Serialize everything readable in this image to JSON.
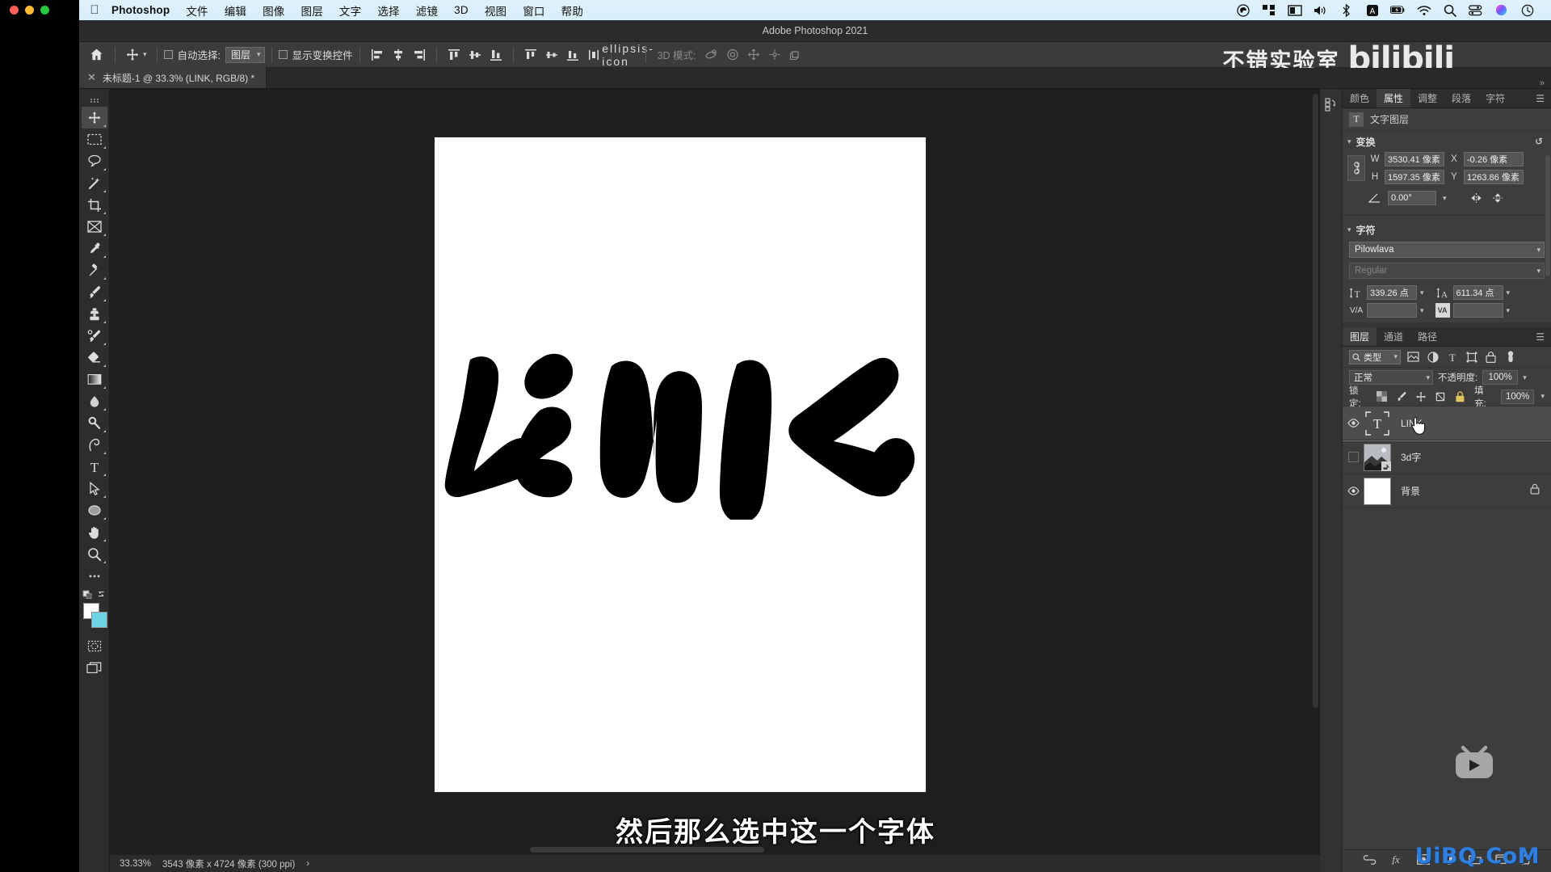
{
  "macbar": {
    "apple_icon": "apple-icon",
    "app_name": "Photoshop",
    "menus": [
      "文件",
      "编辑",
      "图像",
      "图层",
      "文字",
      "选择",
      "滤镜",
      "3D",
      "视图",
      "窗口",
      "帮助"
    ],
    "status_icons": [
      "dropbox-icon",
      "grid-icon",
      "display-icon",
      "volume-icon",
      "bluetooth-icon",
      "input-source-icon",
      "battery-icon",
      "wifi-icon",
      "spotlight-icon",
      "control-center-icon",
      "siri-icon",
      "time-machine-icon"
    ]
  },
  "window": {
    "title": "Adobe Photoshop 2021",
    "traffic_lights": [
      "#ff5f57",
      "#febc2e",
      "#28c840"
    ]
  },
  "options_bar": {
    "home_icon": "home-icon",
    "tool_icon": "move-tool-icon",
    "auto_select_label": "自动选择:",
    "auto_select_value": "图层",
    "show_transform_label": "显示变换控件",
    "align_icons": [
      "align-left-icon",
      "align-center-h-icon",
      "align-right-icon",
      "align-top-icon",
      "align-middle-v-icon",
      "align-bottom-icon",
      "distribute-top-icon",
      "distribute-center-icon",
      "distribute-bottom-icon",
      "distribute-spacing-icon"
    ],
    "more_icon": "ellipsis-icon",
    "mode3d_label": "3D 模式:",
    "mode3d_icons": [
      "orbit-3d-icon",
      "roll-3d-icon",
      "pan-3d-icon",
      "slide-3d-icon",
      "scale-3d-icon"
    ],
    "share_icon": "share-icon",
    "search_icon": "search-icon"
  },
  "watermark": {
    "channel": "不错实验室",
    "brand": "bilibili",
    "site": "UiBQ.CoM",
    "tv_icon": "bilibili-tv-icon"
  },
  "document": {
    "tab_title": "未标题-1 @ 33.3% (LINK, RGB/8) *",
    "close_icon": "close-icon",
    "artwork_text": "LINK"
  },
  "tools": [
    {
      "name": "move-tool",
      "active": true
    },
    {
      "name": "marquee-tool",
      "active": false
    },
    {
      "name": "lasso-tool",
      "active": false
    },
    {
      "name": "magic-wand-tool",
      "active": false
    },
    {
      "name": "crop-tool",
      "active": false
    },
    {
      "name": "frame-tool",
      "active": false
    },
    {
      "name": "eyedropper-tool",
      "active": false
    },
    {
      "name": "healing-brush-tool",
      "active": false
    },
    {
      "name": "brush-tool",
      "active": false
    },
    {
      "name": "clone-stamp-tool",
      "active": false
    },
    {
      "name": "history-brush-tool",
      "active": false
    },
    {
      "name": "eraser-tool",
      "active": false
    },
    {
      "name": "gradient-tool",
      "active": false
    },
    {
      "name": "blur-tool",
      "active": false
    },
    {
      "name": "dodge-tool",
      "active": false
    },
    {
      "name": "pen-tool",
      "active": false
    },
    {
      "name": "type-tool",
      "active": false
    },
    {
      "name": "path-selection-tool",
      "active": false
    },
    {
      "name": "shape-tool",
      "active": false
    },
    {
      "name": "hand-tool",
      "active": false
    },
    {
      "name": "zoom-tool",
      "active": false
    },
    {
      "name": "edit-toolbar",
      "active": false
    }
  ],
  "status_bar": {
    "zoom": "33.33%",
    "doc_size": "3543 像素 x 4724 像素 (300 ppi)",
    "arrow": "›"
  },
  "right_dock": {
    "rail_icons": [
      "libraries-icon",
      "history-icon"
    ],
    "top_tabs": [
      {
        "label": "颜色",
        "active": false
      },
      {
        "label": "属性",
        "active": true
      },
      {
        "label": "调整",
        "active": false
      },
      {
        "label": "段落",
        "active": false
      },
      {
        "label": "字符",
        "active": false
      }
    ],
    "menu_icon": "panel-menu-icon"
  },
  "properties": {
    "layer_type_label": "文字图层",
    "type_badge": "T",
    "transform": {
      "section_label": "变换",
      "reset_icon": "reset-icon",
      "link_icon": "link-aspect-icon",
      "w_label": "W",
      "w_value": "3530.41 像素",
      "x_label": "X",
      "x_value": "-0.26 像素",
      "h_label": "H",
      "h_value": "1597.35 像素",
      "y_label": "Y",
      "y_value": "1263.86 像素",
      "angle_icon": "angle-icon",
      "angle_value": "0.00°",
      "flip_h_icon": "flip-horizontal-icon",
      "flip_v_icon": "flip-vertical-icon"
    },
    "character": {
      "section_label": "字符",
      "font_family": "Pilowlava",
      "font_style": "Regular",
      "size_icon": "font-size-icon",
      "size_value": "339.26 点",
      "leading_icon": "leading-icon",
      "leading_value": "611.34 点",
      "kerning_icon": "V/A",
      "kerning_value": "",
      "tracking_icon": "VA",
      "tracking_value": ""
    }
  },
  "layers_panel": {
    "tabs": [
      {
        "label": "图层",
        "active": true
      },
      {
        "label": "通道",
        "active": false
      },
      {
        "label": "路径",
        "active": false
      }
    ],
    "menu_icon": "panel-menu-icon",
    "filter": {
      "kind_label": "类型",
      "search_icon": "search-icon",
      "filter_icons": [
        "pixel-filter-icon",
        "adjustment-filter-icon",
        "type-filter-icon",
        "shape-filter-icon",
        "smart-object-filter-icon"
      ],
      "toggle_icon": "filter-toggle-icon"
    },
    "blend_mode": "正常",
    "opacity_label": "不透明度:",
    "opacity_value": "100%",
    "lock_label": "锁定:",
    "lock_icons": [
      "lock-transparency-icon",
      "lock-image-icon",
      "lock-position-icon",
      "lock-artboard-icon",
      "lock-all-icon"
    ],
    "fill_label": "填充:",
    "fill_value": "100%",
    "layers": [
      {
        "name": "LINK",
        "visible": true,
        "selected": true,
        "kind": "text",
        "locked": false
      },
      {
        "name": "3d字",
        "visible": false,
        "selected": false,
        "kind": "image",
        "locked": false
      },
      {
        "name": "背景",
        "visible": true,
        "selected": false,
        "kind": "background",
        "locked": true
      }
    ],
    "footer_icons": [
      "link-layers-icon",
      "layer-style-icon",
      "layer-mask-icon",
      "adjustment-layer-icon",
      "new-group-icon",
      "new-layer-icon",
      "delete-layer-icon"
    ]
  },
  "subtitle": "然后那么选中这一个字体",
  "colors": {
    "accent": "#2f7fe0",
    "panel_bg": "#3d3d3d",
    "app_bg": "#232323",
    "canvas_bg": "#1e1e1e",
    "foreground_swatch": "#ffffff",
    "background_swatch": "#6fd3e6"
  }
}
